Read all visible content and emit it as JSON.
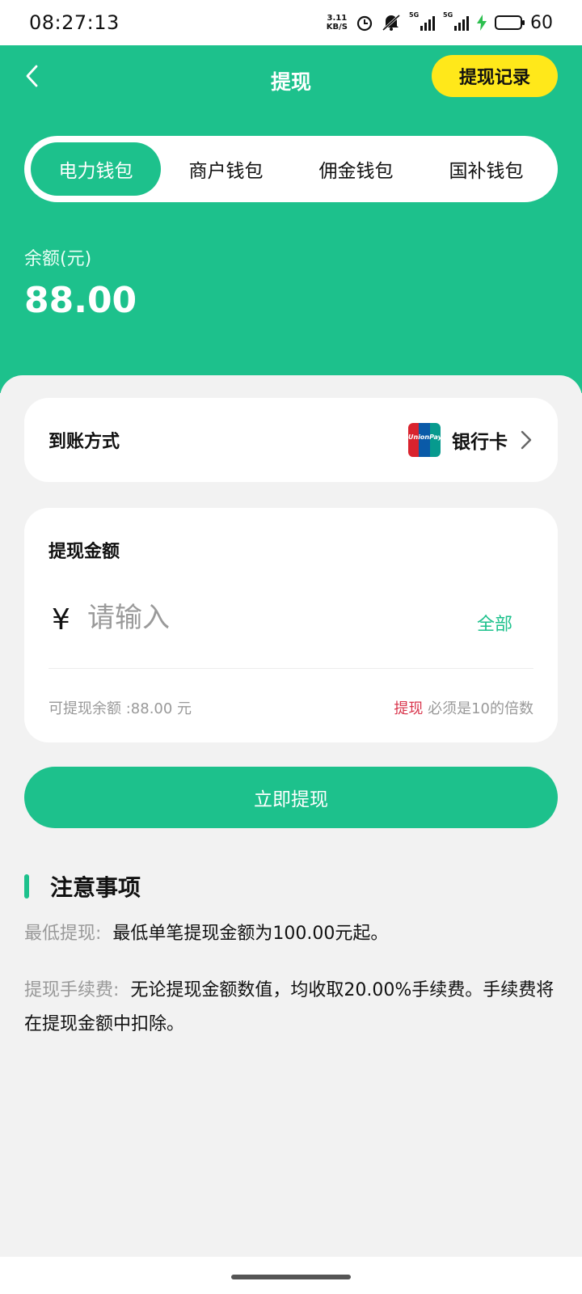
{
  "status_bar": {
    "time": "08:27:13",
    "net_speed_value": "3.11",
    "net_speed_unit": "KB/S",
    "signal1_tag": "5G",
    "signal2_tag": "5G",
    "battery": "60"
  },
  "header": {
    "title": "提现",
    "records_button": "提现记录",
    "tabs": [
      {
        "label": "电力钱包",
        "active": true
      },
      {
        "label": "商户钱包",
        "active": false
      },
      {
        "label": "佣金钱包",
        "active": false
      },
      {
        "label": "国补钱包",
        "active": false
      }
    ],
    "balance_label": "余额(元)",
    "balance_value": "88.00"
  },
  "payout": {
    "label": "到账方式",
    "method": "银行卡",
    "method_icon": "unionpay-icon",
    "icon_text": "UnionPay"
  },
  "amount": {
    "title": "提现金额",
    "currency": "¥",
    "placeholder": "请输入",
    "all_label": "全部",
    "available_text": "可提现余额 :88.00 元",
    "rule_highlight": "提现",
    "rule_text": " 必须是10的倍数"
  },
  "submit_label": "立即提现",
  "notes": {
    "title": "注意事项",
    "items": [
      {
        "key": "最低提现:",
        "value": "最低单笔提现金额为100.00元起。"
      },
      {
        "key": "提现手续费:",
        "value": "无论提现金额数值，均收取20.00%手续费。手续费将在提现金额中扣除。"
      }
    ]
  },
  "colors": {
    "brand_green": "#1dc18c",
    "accent_yellow": "#ffe81a",
    "warning_red": "#d8344b"
  }
}
